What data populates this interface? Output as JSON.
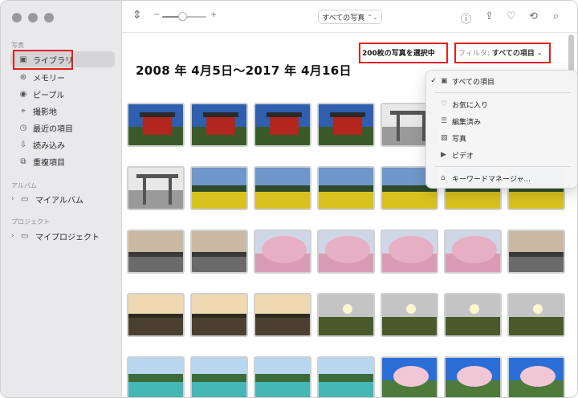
{
  "sidebar": {
    "photos_section": "写真",
    "items": [
      {
        "label": "ライブラリ",
        "icon": "library-icon"
      },
      {
        "label": "メモリー",
        "icon": "memories-icon"
      },
      {
        "label": "ピープル",
        "icon": "people-icon"
      },
      {
        "label": "撮影地",
        "icon": "places-icon"
      },
      {
        "label": "最近の項目",
        "icon": "recents-icon"
      },
      {
        "label": "読み込み",
        "icon": "imports-icon"
      },
      {
        "label": "重複項目",
        "icon": "duplicates-icon"
      }
    ],
    "albums_section": "アルバム",
    "my_albums": "マイアルバム",
    "projects_section": "プロジェクト",
    "my_projects": "マイプロジェクト"
  },
  "toolbar": {
    "minus": "−",
    "plus": "+",
    "zoom_level": 0.45,
    "view_select": "すべての写真"
  },
  "main": {
    "date_range": "2008 年 4月5日〜2017 年 4月16日",
    "selected_count": "200枚の写真を選択中",
    "filter_prefix": "フィルタ:",
    "filter_value": "すべての項目"
  },
  "filter_menu": {
    "items": [
      {
        "label": "すべての項目",
        "checked": true,
        "icon": "photos-stack-icon"
      },
      {
        "label": "お気に入り",
        "checked": false,
        "icon": "heart-icon"
      },
      {
        "label": "編集済み",
        "checked": false,
        "icon": "sliders-icon"
      },
      {
        "label": "写真",
        "checked": false,
        "icon": "photo-icon"
      },
      {
        "label": "ビデオ",
        "checked": false,
        "icon": "video-icon"
      },
      {
        "label": "キーワードマネージャ...",
        "checked": false,
        "icon": "tag-icon"
      }
    ]
  },
  "colors": {
    "selection_box": "#e3201b",
    "sidebar_bg": "#e9e8ea",
    "active_item_bg": "#d4d3d6"
  }
}
